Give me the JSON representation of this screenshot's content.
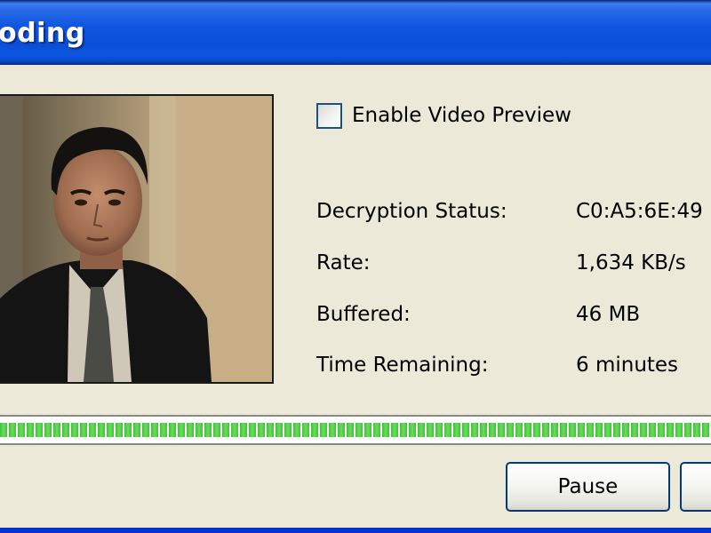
{
  "window": {
    "title_visible": "oding"
  },
  "video_preview": {
    "icon": "video-thumbnail"
  },
  "checkbox": {
    "label": "Enable Video Preview",
    "checked": false
  },
  "status": {
    "rows": [
      {
        "label": "Decryption Status:",
        "value": "C0:A5:6E:49"
      },
      {
        "label": "Rate:",
        "value": "1,634 KB/s"
      },
      {
        "label": "Buffered:",
        "value": "46 MB"
      },
      {
        "label": "Time Remaining:",
        "value": "6 minutes"
      }
    ]
  },
  "progress": {
    "fraction": 1.0,
    "color": "#3dc23d"
  },
  "buttons": {
    "pause_label": "Pause",
    "cancel_label": ""
  },
  "colors": {
    "titlebar": "#0f55e0",
    "window_bg": "#ece9d8",
    "button_border": "#003c74"
  }
}
